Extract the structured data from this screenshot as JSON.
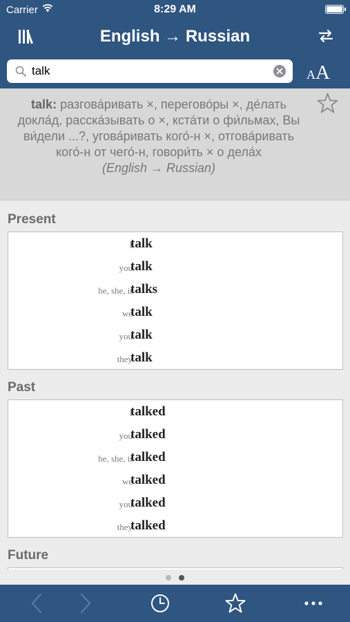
{
  "status_bar": {
    "carrier": "Carrier",
    "time": "8:29 AM"
  },
  "nav": {
    "title": "English → Russian"
  },
  "search": {
    "value": "talk",
    "placeholder": ""
  },
  "font_size_button": {
    "small": "A",
    "big": "A"
  },
  "translation": {
    "headword": "talk:",
    "body": "разгова́ривать ×, перегово́ры ×, де́лать докла́д, расска́зывать  о ×, кста́ти о фи́льмах, Вы ви́дели ...?, угова́ривать  кого́-н ×, отгова́ривать  кого́-н от чего́-н, говори́ть × о дела́х",
    "direction_open": "(",
    "direction": "English → Russian",
    "direction_close": ")"
  },
  "sections": [
    {
      "title": "Present",
      "rows": [
        {
          "pronoun": "I",
          "form": "talk"
        },
        {
          "pronoun": "you",
          "form": "talk"
        },
        {
          "pronoun": "he, she, it",
          "form": "talks"
        },
        {
          "pronoun": "we",
          "form": "talk"
        },
        {
          "pronoun": "you",
          "form": "talk"
        },
        {
          "pronoun": "they",
          "form": "talk"
        }
      ]
    },
    {
      "title": "Past",
      "rows": [
        {
          "pronoun": "I",
          "form": "talked"
        },
        {
          "pronoun": "you",
          "form": "talked"
        },
        {
          "pronoun": "he, she, it",
          "form": "talked"
        },
        {
          "pronoun": "we",
          "form": "talked"
        },
        {
          "pronoun": "you",
          "form": "talked"
        },
        {
          "pronoun": "they",
          "form": "talked"
        }
      ]
    },
    {
      "title": "Future",
      "rows": []
    }
  ],
  "pager": {
    "pages": 2,
    "current": 2
  },
  "tabs": [
    "back-icon",
    "forward-icon",
    "history-clock-icon",
    "favorites-star-icon",
    "more-icon"
  ],
  "colors": {
    "bar": "#2f5581",
    "translation_bg": "#d8d8d8",
    "content_bg": "#ececec"
  }
}
